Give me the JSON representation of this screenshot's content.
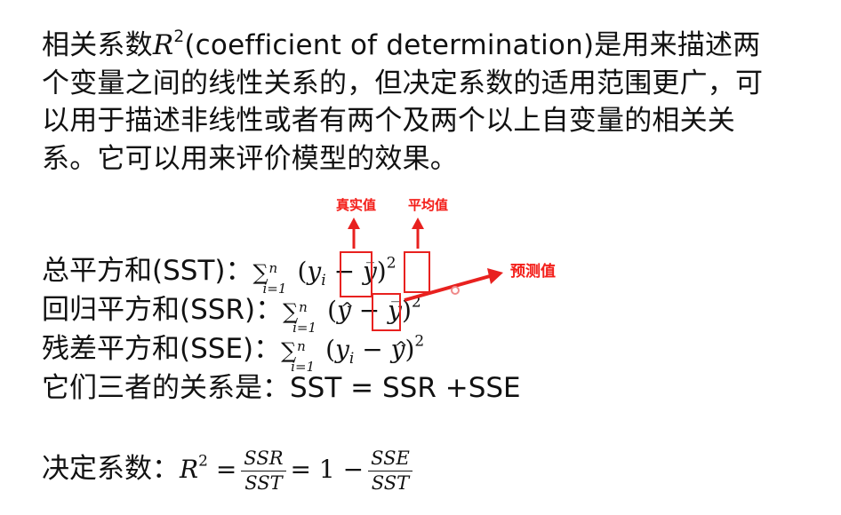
{
  "intro": {
    "before": "相关系数",
    "symbol": "R",
    "exponent": "2",
    "after": "(coefficient of determination)是用来描述两个变量之间的线性关系的，但决定系数的适用范围更广，可以用于描述非线性或者有两个及两个以上自变量的相关关系。它可以用来评价模型的效果。"
  },
  "formulas": {
    "sst": {
      "label": "总平方和(SST)：",
      "sum_symbol": "∑",
      "sum_upper": "n",
      "sum_lower": "i=1",
      "open": "(",
      "term1": "y",
      "term1_sub": "i",
      "minus": " − ",
      "term2": "y",
      "term2_accent": "‾",
      "close": ")",
      "power": "2"
    },
    "ssr": {
      "label": "回归平方和(SSR)：",
      "sum_symbol": "∑",
      "sum_upper": "n",
      "sum_lower": "i=1",
      "open": "(",
      "term1": "y",
      "term1_accent": "^",
      "minus": " − ",
      "term2": "y",
      "term2_accent": "‾",
      "close": ")",
      "power": "2"
    },
    "sse": {
      "label": "残差平方和(SSE)：",
      "sum_symbol": "∑",
      "sum_upper": "n",
      "sum_lower": "i=1",
      "open": "(",
      "term1": "y",
      "term1_sub": "i",
      "minus": " − ",
      "term2": "y",
      "term2_accent": "^",
      "close": ")",
      "power": "2"
    },
    "relation": "它们三者的关系是：SST = SSR +SSE"
  },
  "determination": {
    "label": "决定系数：",
    "symbol": "R",
    "power": "2",
    "eq1": "=",
    "frac1_num": "SSR",
    "frac1_den": "SST",
    "eq2": "= 1 −",
    "frac2_num": "SSE",
    "frac2_den": "SST"
  },
  "annotations": {
    "true_value": "真实值",
    "mean_value": "平均值",
    "predicted_value": "预测值",
    "color": "#f3201b"
  }
}
